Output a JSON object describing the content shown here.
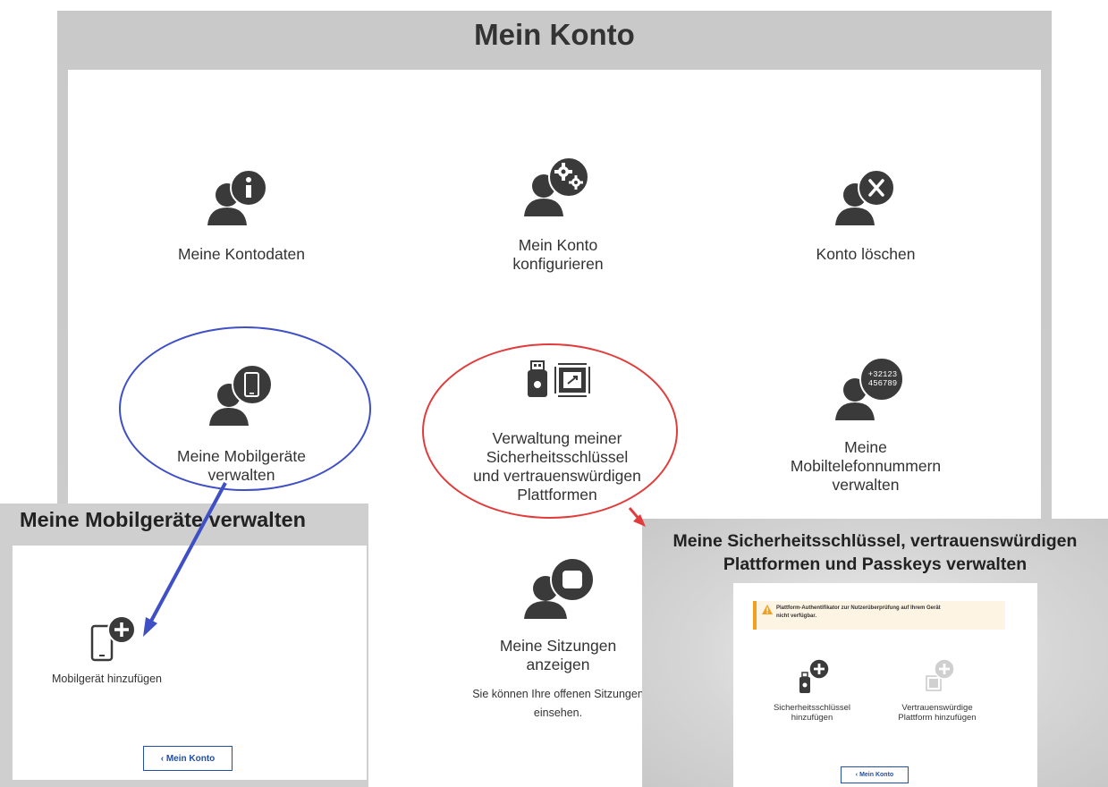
{
  "main": {
    "title": "Mein Konto",
    "tiles": [
      {
        "label_lines": [
          "Meine Kontodaten"
        ],
        "icon": "account-info-icon"
      },
      {
        "label_lines": [
          "Mein Konto",
          "konfigurieren"
        ],
        "icon": "account-settings-icon"
      },
      {
        "label_lines": [
          "Konto löschen"
        ],
        "icon": "account-delete-icon"
      },
      {
        "label_lines": [
          "Meine Mobilgeräte",
          "verwalten"
        ],
        "icon": "account-mobile-icon"
      },
      {
        "label_lines": [
          "Verwaltung meiner",
          "Sicherheitsschlüssel",
          "und vertrauenswürdigen",
          "Plattformen"
        ],
        "icon": "security-key-chip-icon"
      },
      {
        "label_lines": [
          "Meine",
          "Mobiltelefonnummern",
          "verwalten"
        ],
        "icon": "account-phone-numbers-icon",
        "icon_text": [
          "+32123",
          "456789"
        ]
      },
      {
        "label_lines": [
          "Meine Sitzungen",
          "anzeigen"
        ],
        "description_lines": [
          "Sie können Ihre offenen Sitzungen",
          "einsehen."
        ],
        "icon": "account-sessions-icon"
      }
    ]
  },
  "annotations": {
    "left_ellipse_color": "#3f4fc6",
    "right_ellipse_color": "#e23b3b",
    "left_arrow_color": "#3f4fc6",
    "right_arrow_color": "#e23b3b"
  },
  "inset_mobile": {
    "title": "Meine Mobilgeräte verwalten",
    "add_label": "Mobilgerät hinzufügen",
    "back_button": "‹ Mein Konto"
  },
  "inset_security": {
    "title_lines": [
      "Meine Sicherheitsschlüssel, vertrauenswürdigen",
      "Plattformen und Passkeys verwalten"
    ],
    "warning_lines": [
      "Plattform-Authentifikator zur Nutzerüberprüfung auf Ihrem Gerät",
      "nicht verfügbar."
    ],
    "warning_color": "#f0a020",
    "add_key_lines": [
      "Sicherheitsschlüssel",
      "hinzufügen"
    ],
    "add_platform_lines": [
      "Vertrauenswürdige",
      "Plattform hinzufügen"
    ],
    "back_button": "‹ Mein Konto"
  }
}
